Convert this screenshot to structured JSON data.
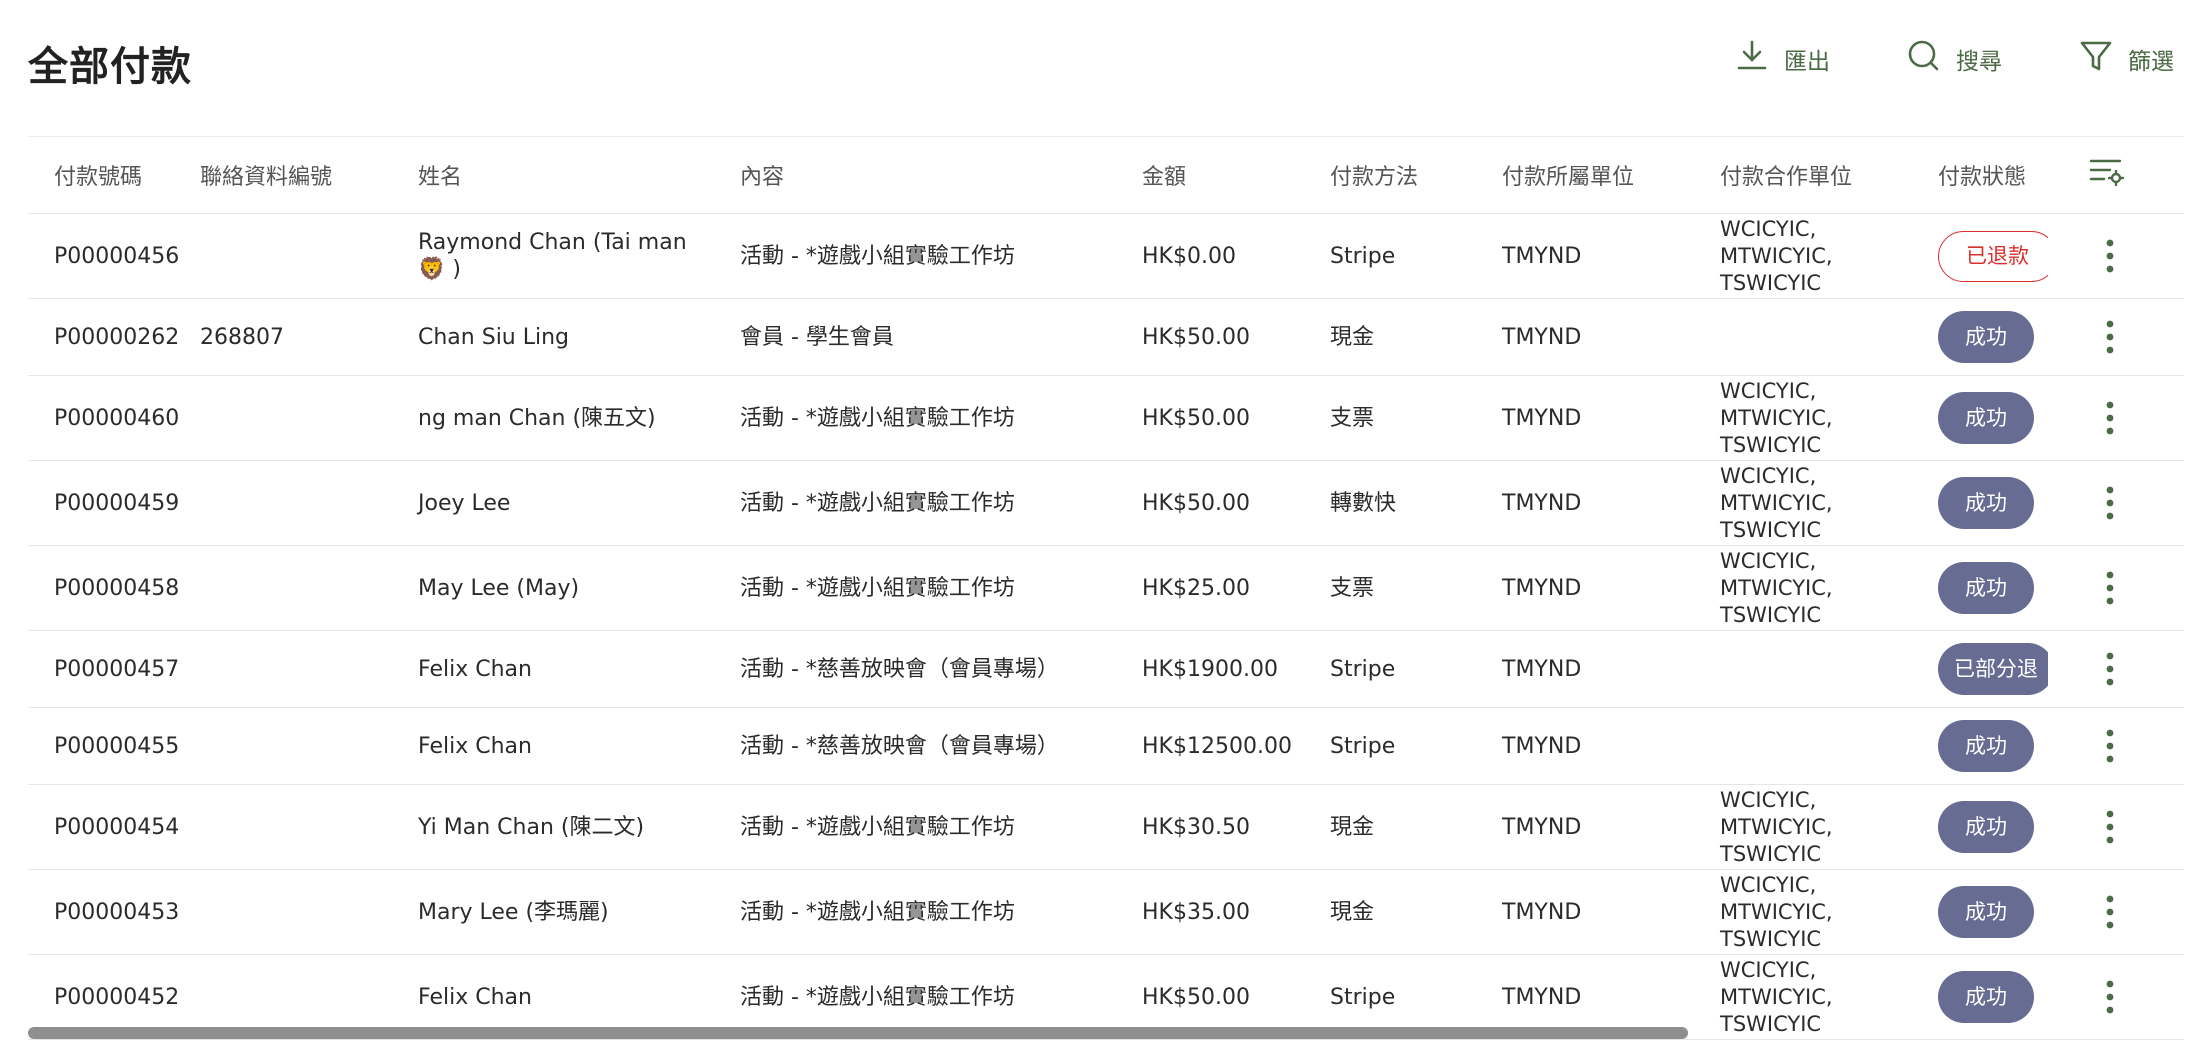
{
  "page": {
    "title": "全部付款"
  },
  "toolbar": {
    "export_label": "匯出",
    "search_label": "搜尋",
    "filter_label": "篩選"
  },
  "colors": {
    "accent_green": "#4b6b45",
    "status_success_bg": "#676c93",
    "status_refunded": "#d8312d"
  },
  "table": {
    "headers": [
      "付款號碼",
      "聯絡資料編號",
      "姓名",
      "內容",
      "金額",
      "付款方法",
      "付款所屬單位",
      "付款合作單位",
      "付款狀態"
    ],
    "rows": [
      {
        "id": "P00000456",
        "contact": "",
        "name": "Raymond Chan (Tai man\n🦁 )",
        "content": "活動 - *遊戲小組實驗工作坊",
        "amount": "HK$0.00",
        "method": "Stripe",
        "unit": "TMYND",
        "partner": "WCICYIC,\nMTWICYIC,\nTSWICYIC",
        "status": "已退款",
        "status_type": "refunded"
      },
      {
        "id": "P00000262",
        "contact": "268807",
        "name": "Chan Siu Ling",
        "content": "會員 - 學生會員",
        "amount": "HK$50.00",
        "method": "現金",
        "unit": "TMYND",
        "partner": "",
        "status": "成功",
        "status_type": "success"
      },
      {
        "id": "P00000460",
        "contact": "",
        "name": "ng man Chan (陳五文)",
        "content": "活動 - *遊戲小組實驗工作坊",
        "amount": "HK$50.00",
        "method": "支票",
        "unit": "TMYND",
        "partner": "WCICYIC,\nMTWICYIC,\nTSWICYIC",
        "status": "成功",
        "status_type": "success"
      },
      {
        "id": "P00000459",
        "contact": "",
        "name": "Joey Lee",
        "content": "活動 - *遊戲小組實驗工作坊",
        "amount": "HK$50.00",
        "method": "轉數快",
        "unit": "TMYND",
        "partner": "WCICYIC,\nMTWICYIC,\nTSWICYIC",
        "status": "成功",
        "status_type": "success"
      },
      {
        "id": "P00000458",
        "contact": "",
        "name": "May Lee (May)",
        "content": "活動 - *遊戲小組實驗工作坊",
        "amount": "HK$25.00",
        "method": "支票",
        "unit": "TMYND",
        "partner": "WCICYIC,\nMTWICYIC,\nTSWICYIC",
        "status": "成功",
        "status_type": "success"
      },
      {
        "id": "P00000457",
        "contact": "",
        "name": "Felix Chan",
        "content": "活動 - *慈善放映會（會員專場）",
        "amount": "HK$1900.00",
        "method": "Stripe",
        "unit": "TMYND",
        "partner": "",
        "status": "已部分退",
        "status_type": "partial"
      },
      {
        "id": "P00000455",
        "contact": "",
        "name": "Felix Chan",
        "content": "活動 - *慈善放映會（會員專場）",
        "amount": "HK$12500.00",
        "method": "Stripe",
        "unit": "TMYND",
        "partner": "",
        "status": "成功",
        "status_type": "success"
      },
      {
        "id": "P00000454",
        "contact": "",
        "name": "Yi Man Chan (陳二文)",
        "content": "活動 - *遊戲小組實驗工作坊",
        "amount": "HK$30.50",
        "method": "現金",
        "unit": "TMYND",
        "partner": "WCICYIC,\nMTWICYIC,\nTSWICYIC",
        "status": "成功",
        "status_type": "success"
      },
      {
        "id": "P00000453",
        "contact": "",
        "name": "Mary Lee (李瑪麗)",
        "content": "活動 - *遊戲小組實驗工作坊",
        "amount": "HK$35.00",
        "method": "現金",
        "unit": "TMYND",
        "partner": "WCICYIC,\nMTWICYIC,\nTSWICYIC",
        "status": "成功",
        "status_type": "success"
      },
      {
        "id": "P00000452",
        "contact": "",
        "name": "Felix Chan",
        "content": "活動 - *遊戲小組實驗工作坊",
        "amount": "HK$50.00",
        "method": "Stripe",
        "unit": "TMYND",
        "partner": "WCICYIC,\nMTWICYIC,\nTSWICYIC",
        "status": "成功",
        "status_type": "success"
      }
    ]
  }
}
